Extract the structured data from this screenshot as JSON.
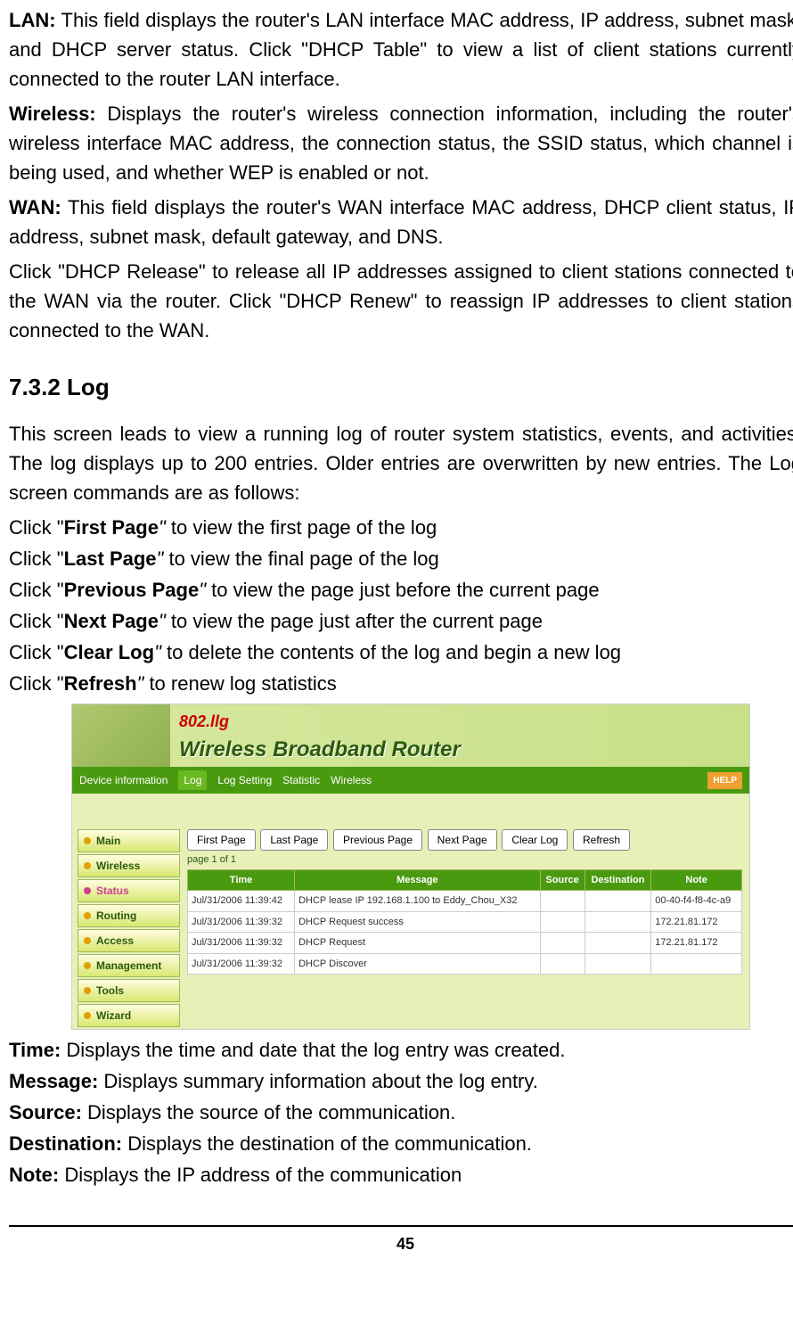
{
  "paras": {
    "lan_label": "LAN:",
    "lan_text": " This field displays the router's LAN interface MAC address, IP address, subnet mask, and DHCP server status. Click \"DHCP Table\" to view a list of client stations currently connected to the router LAN interface.",
    "wireless_label": "Wireless:",
    "wireless_text": " Displays the router's wireless connection information, including the router's wireless interface MAC address, the connection status, the SSID status, which channel is being used, and whether WEP is enabled or not.",
    "wan_label": "WAN:",
    "wan_text": " This field displays the router's WAN interface MAC address, DHCP client status, IP address, subnet mask, default gateway, and DNS.",
    "dhcp_text": "Click \"DHCP Release\" to release all IP addresses assigned to client stations connected to the WAN via the router. Click \"DHCP Renew\" to reassign IP addresses to client stations connected to the WAN."
  },
  "section_heading": "7.3.2    Log",
  "log_intro": "This screen leads to view a running log of router system statistics, events, and activities. The log displays up to 200 entries. Older entries are overwritten by new entries. The Log screen commands are as follows:",
  "cmds": [
    {
      "pre": "Click \"",
      "bold": "First Page",
      "post": "\" to view the first page of the log"
    },
    {
      "pre": "Click \"",
      "bold": "Last Page",
      "post": "\" to view the final page of the log"
    },
    {
      "pre": "Click \"",
      "bold": "Previous Page",
      "post": "\" to view the page just before the current page"
    },
    {
      "pre": "Click \"",
      "bold": "Next Page",
      "post": "\" to view the page just after the current page"
    },
    {
      "pre": "Click \"",
      "bold": "Clear Log",
      "post": "\" to delete the contents of the log and begin a new log"
    },
    {
      "pre": "Click \"",
      "bold": "Refresh",
      "post": "\" to renew log statistics"
    }
  ],
  "router_ui": {
    "brand": "802.llg",
    "slogan": "Wireless Broadband Router",
    "tabs": [
      "Device information",
      "Log",
      "Log Setting",
      "Statistic",
      "Wireless"
    ],
    "help": "HELP",
    "sidebar": [
      "Main",
      "Wireless",
      "Status",
      "Routing",
      "Access",
      "Management",
      "Tools",
      "Wizard"
    ],
    "buttons": [
      "First Page",
      "Last Page",
      "Previous Page",
      "Next Page",
      "Clear Log",
      "Refresh"
    ],
    "page_of": "page 1 of 1",
    "headers": [
      "Time",
      "Message",
      "Source",
      "Destination",
      "Note"
    ],
    "rows": [
      {
        "time": "Jul/31/2006 11:39:42",
        "msg": "DHCP lease IP 192.168.1.100 to Eddy_Chou_X32",
        "src": "",
        "dst": "",
        "note": "00-40-f4-f8-4c-a9"
      },
      {
        "time": "Jul/31/2006 11:39:32",
        "msg": "DHCP Request success",
        "src": "",
        "dst": "",
        "note": "172.21.81.172"
      },
      {
        "time": "Jul/31/2006 11:39:32",
        "msg": "DHCP Request",
        "src": "",
        "dst": "",
        "note": "172.21.81.172"
      },
      {
        "time": "Jul/31/2006 11:39:32",
        "msg": "DHCP Discover",
        "src": "",
        "dst": "",
        "note": ""
      }
    ]
  },
  "descs": [
    {
      "bold": "Time:",
      "text": " Displays the time and date that the log entry was created."
    },
    {
      "bold": "Message:",
      "text": " Displays summary information about the log entry."
    },
    {
      "bold": "Source:",
      "text": " Displays the source of the communication."
    },
    {
      "bold": "Destination:",
      "text": " Displays the destination of the communication."
    },
    {
      "bold": "Note:",
      "text": " Displays the IP address of the communication"
    }
  ],
  "page_number": "45"
}
